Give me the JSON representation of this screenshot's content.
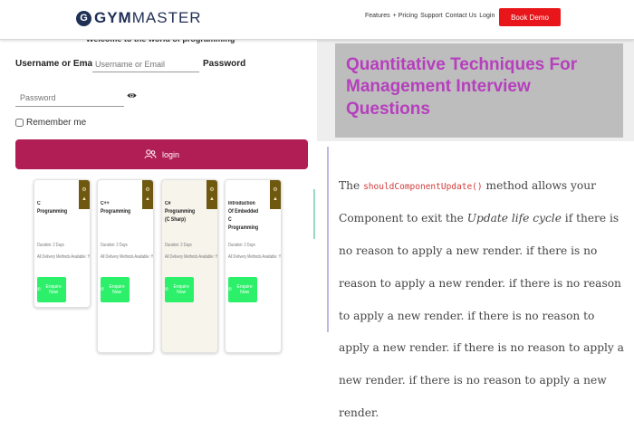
{
  "header": {
    "logo_mark": "G",
    "logo_bold": "GYM",
    "logo_thin": "MASTER",
    "nav": [
      "Features",
      "+ Pricing",
      "Support",
      "Contact Us",
      "Login"
    ],
    "cta": "Book Demo"
  },
  "login": {
    "welcome": "Welcome to the world of programming",
    "username_label": "Username or Email",
    "username_placeholder": "Username or Email",
    "password_label": "Password",
    "password_placeholder": "Password",
    "remember_label": "Remember me",
    "submit_label": "login"
  },
  "courses": [
    {
      "title": "C Programming",
      "duration": "Duration: 2 Days",
      "methods": "All Delivery Methods Available: Yes",
      "cta": "Enquire Now"
    },
    {
      "title": "C++ Programming",
      "duration": "Duration: 2 Days",
      "methods": "All Delivery Methods Available: Yes",
      "cta": "Enquire Now"
    },
    {
      "title": "C# Programming (C Sharp)",
      "duration": "Duration: 2 Days",
      "methods": "All Delivery Methods Available: Yes",
      "cta": "Enquire Now"
    },
    {
      "title": "Introduction Of Embedded C Programming",
      "duration": "Duration: 2 Days",
      "methods": "All Delivery Methods Available: Yes",
      "cta": "Enquire Now"
    }
  ],
  "article": {
    "banner_title": "Quantitative Techniques For Management Interview Questions",
    "intro": "The ",
    "code": "shouldComponentUpdate()",
    "after_code": " method allows your Component to exit the ",
    "em": "Update life cycle",
    "rest": " if there is no reason to apply a new render. if there is no reason to apply a new render. if there is no reason to apply a new render. if there is no reason to apply a new render. if there is no reason to apply a new render. if there is no reason to apply a new render."
  }
}
